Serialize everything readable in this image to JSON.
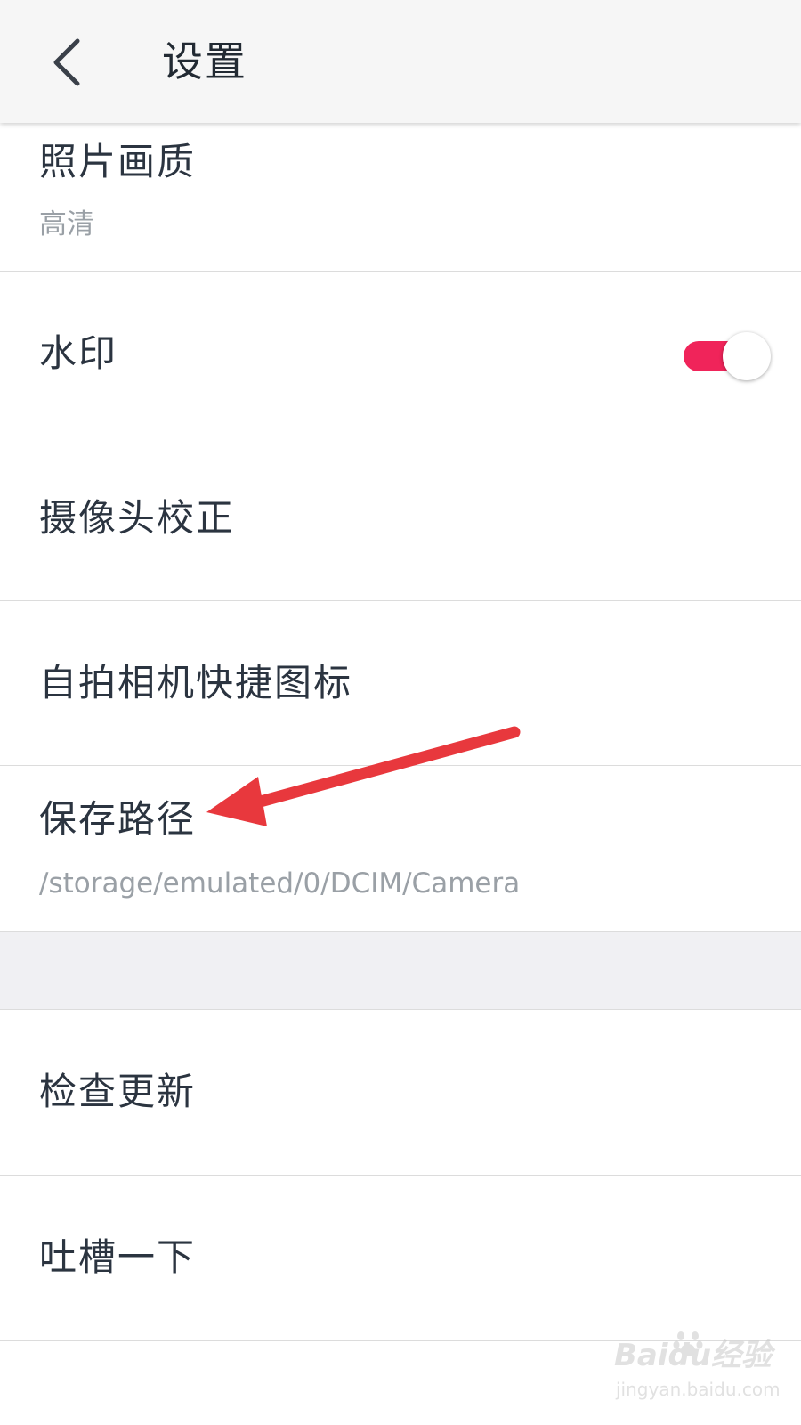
{
  "header": {
    "title": "设置",
    "back_icon": "chevron-left-icon"
  },
  "settings": {
    "photo_quality": {
      "label": "照片画质",
      "value": "高清"
    },
    "watermark": {
      "label": "水印",
      "enabled": true
    },
    "camera_calibration": {
      "label": "摄像头校正"
    },
    "selfie_shortcut": {
      "label": "自拍相机快捷图标"
    },
    "save_path": {
      "label": "保存路径",
      "value": "/storage/emulated/0/DCIM/Camera"
    },
    "check_update": {
      "label": "检查更新"
    },
    "feedback": {
      "label": "吐槽一下"
    }
  },
  "annotation": {
    "icon": "red-arrow-icon",
    "color": "#e8383d",
    "points_to": "save_path"
  },
  "watermark_logo": {
    "brand": "Baidu经验",
    "url": "jingyan.baidu.com"
  },
  "colors": {
    "accent": "#f0245a",
    "header_bg": "#f6f6f6",
    "divider": "#dcdcdc",
    "section_gap": "#f0f0f3",
    "primary_text": "#2b3440",
    "secondary_text": "#9aa0a6"
  }
}
